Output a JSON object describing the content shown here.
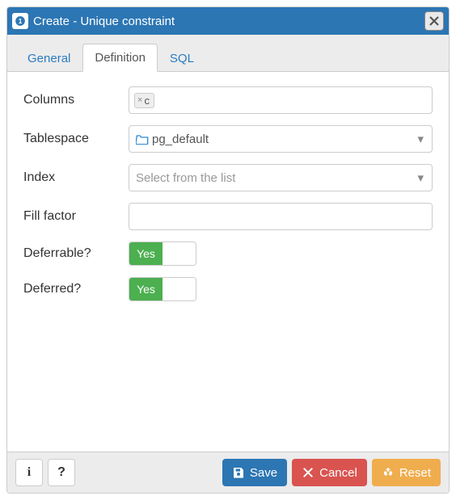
{
  "header": {
    "title": "Create - Unique constraint"
  },
  "tabs": [
    {
      "label": "General",
      "active": false
    },
    {
      "label": "Definition",
      "active": true
    },
    {
      "label": "SQL",
      "active": false
    }
  ],
  "form": {
    "columns": {
      "label": "Columns",
      "tags": [
        "c"
      ]
    },
    "tablespace": {
      "label": "Tablespace",
      "value": "pg_default"
    },
    "index": {
      "label": "Index",
      "placeholder": "Select from the list"
    },
    "fillfactor": {
      "label": "Fill factor",
      "value": ""
    },
    "deferrable": {
      "label": "Deferrable?",
      "toggle_on_label": "Yes"
    },
    "deferred": {
      "label": "Deferred?",
      "toggle_on_label": "Yes"
    }
  },
  "footer": {
    "save": "Save",
    "cancel": "Cancel",
    "reset": "Reset"
  }
}
